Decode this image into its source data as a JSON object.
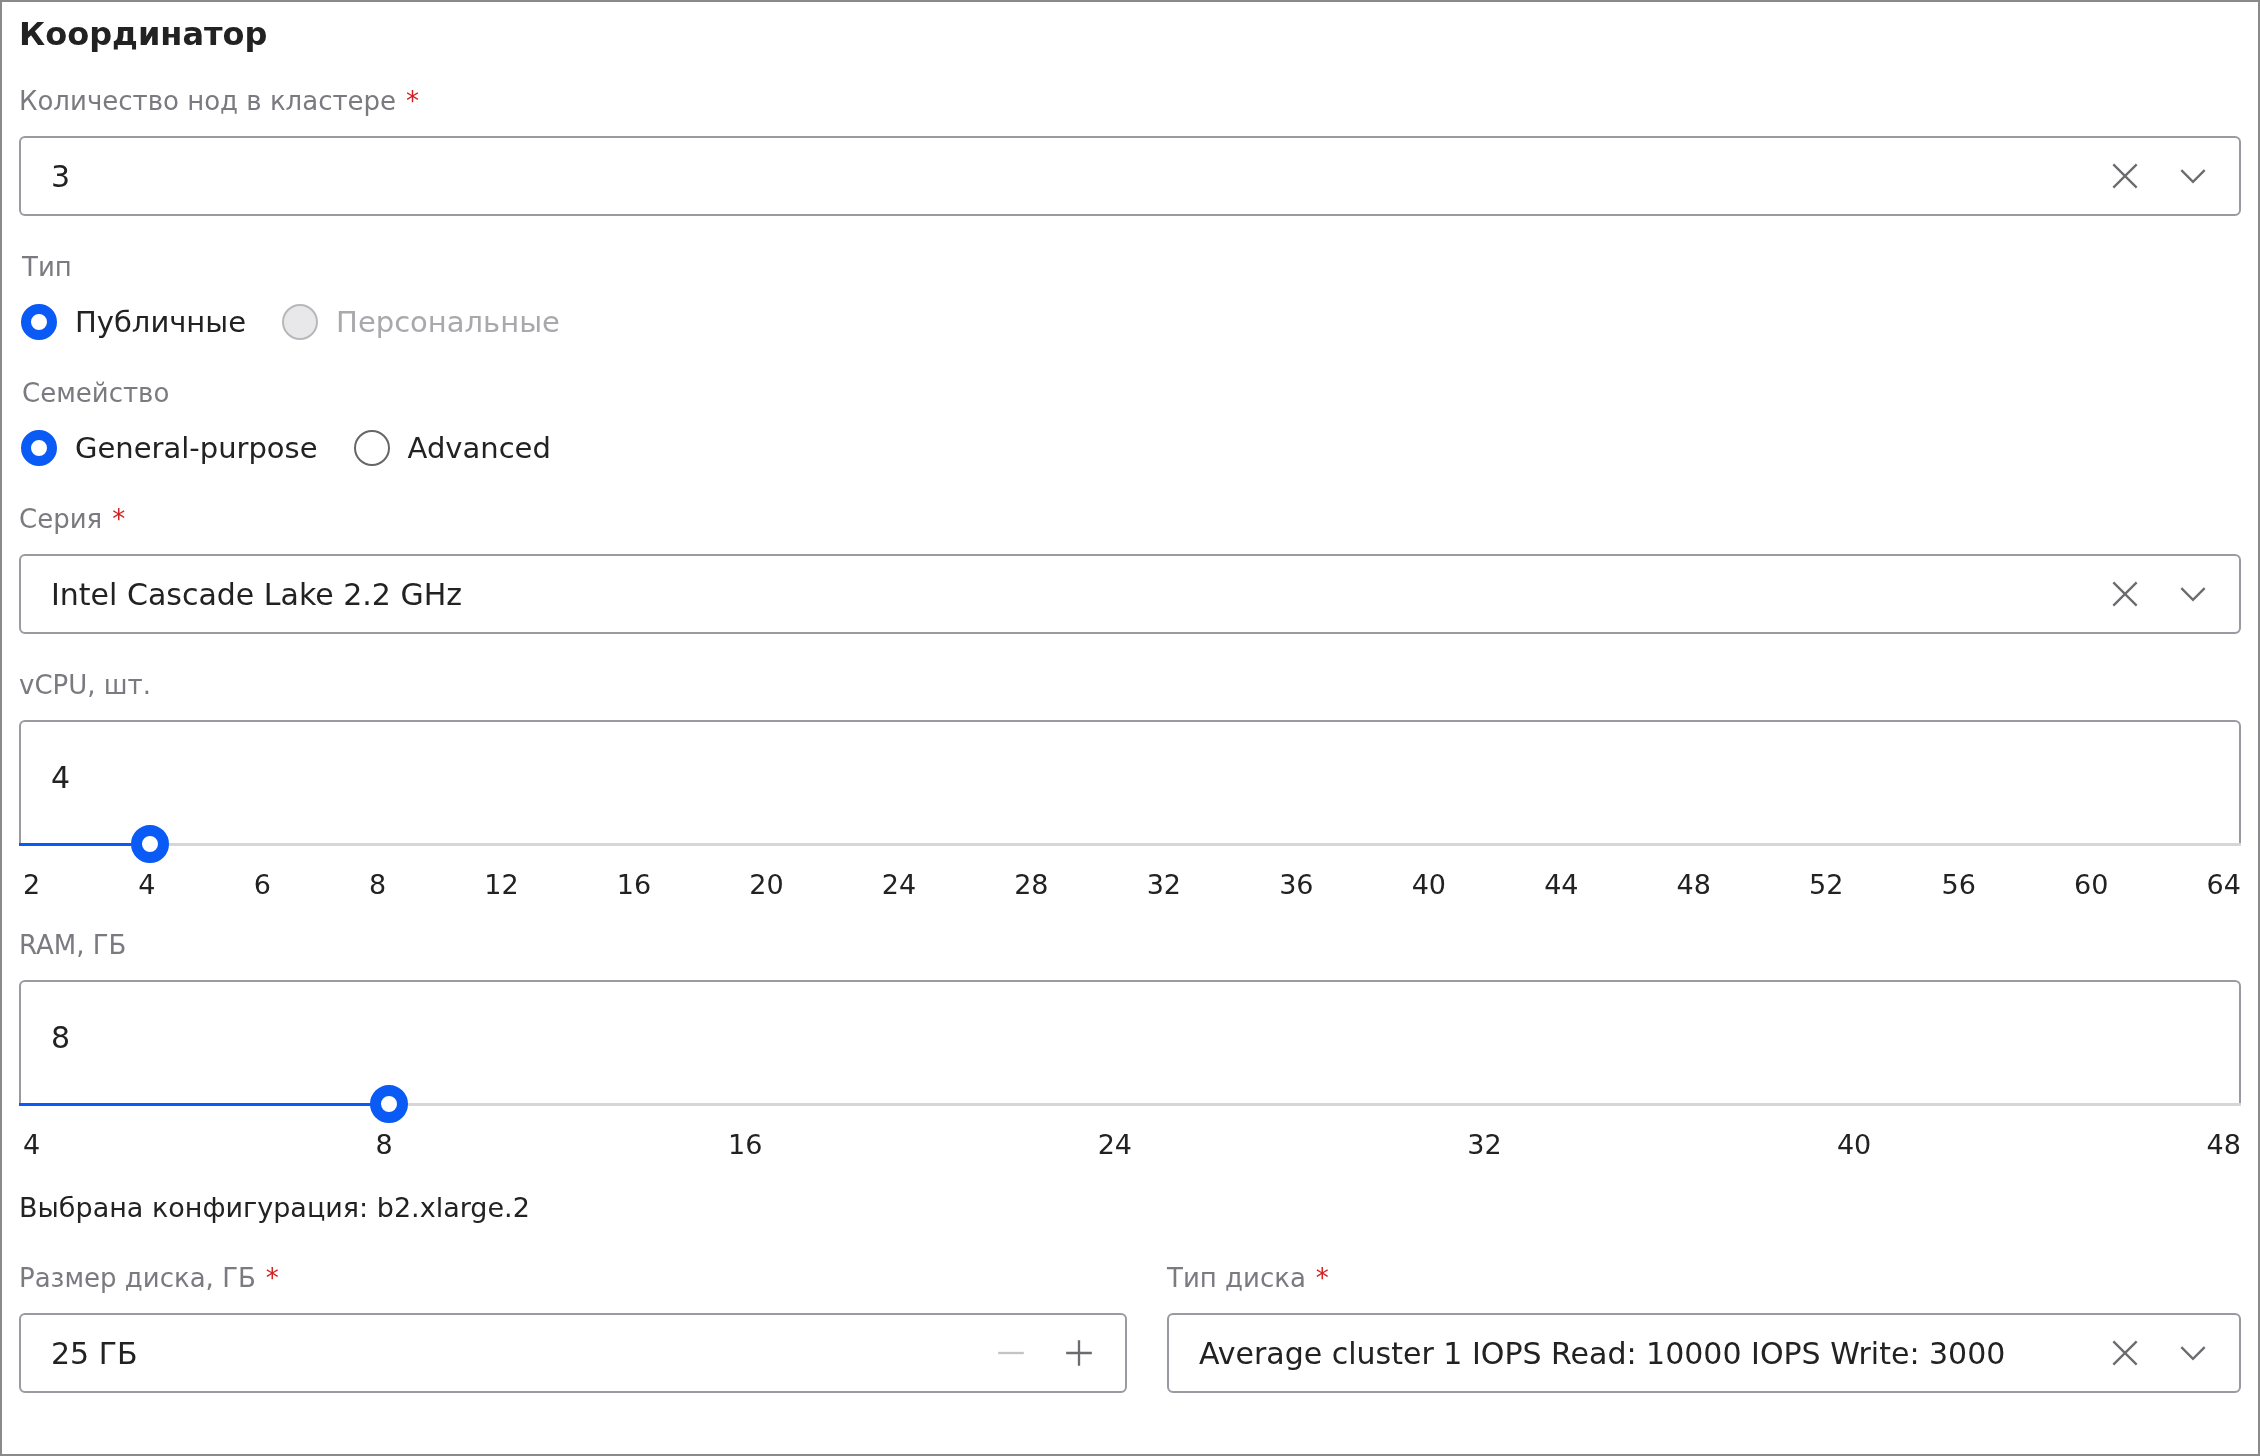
{
  "title": "Координатор",
  "nodes": {
    "label": "Количество нод в кластере",
    "required_mark": "*",
    "value": "3"
  },
  "type": {
    "label": "Тип",
    "options": [
      {
        "label": "Публичные",
        "selected": true,
        "disabled": false
      },
      {
        "label": "Персональные",
        "selected": false,
        "disabled": true
      }
    ]
  },
  "family": {
    "label": "Семейство",
    "options": [
      {
        "label": "General-purpose",
        "selected": true,
        "disabled": false
      },
      {
        "label": "Advanced",
        "selected": false,
        "disabled": false
      }
    ]
  },
  "series": {
    "label": "Серия",
    "required_mark": "*",
    "value": "Intel Cascade Lake 2.2 GHz"
  },
  "vcpu": {
    "label": "vCPU, шт.",
    "value": "4",
    "level": 0.0588,
    "ticks": [
      "2",
      "4",
      "6",
      "8",
      "12",
      "16",
      "20",
      "24",
      "28",
      "32",
      "36",
      "40",
      "44",
      "48",
      "52",
      "56",
      "60",
      "64"
    ]
  },
  "ram": {
    "label": "RAM, ГБ",
    "value": "8",
    "level": 0.1667,
    "ticks": [
      "4",
      "8",
      "16",
      "24",
      "32",
      "40",
      "48"
    ]
  },
  "configuration": "Выбрана конфигурация: b2.xlarge.2",
  "disk_size": {
    "label": "Размер диска, ГБ",
    "required_mark": "*",
    "value": "25 ГБ",
    "decrement_disabled": true
  },
  "disk_type": {
    "label": "Тип диска",
    "required_mark": "*",
    "value": "Average cluster 1 IOPS Read: 10000 IOPS Write: 3000"
  }
}
